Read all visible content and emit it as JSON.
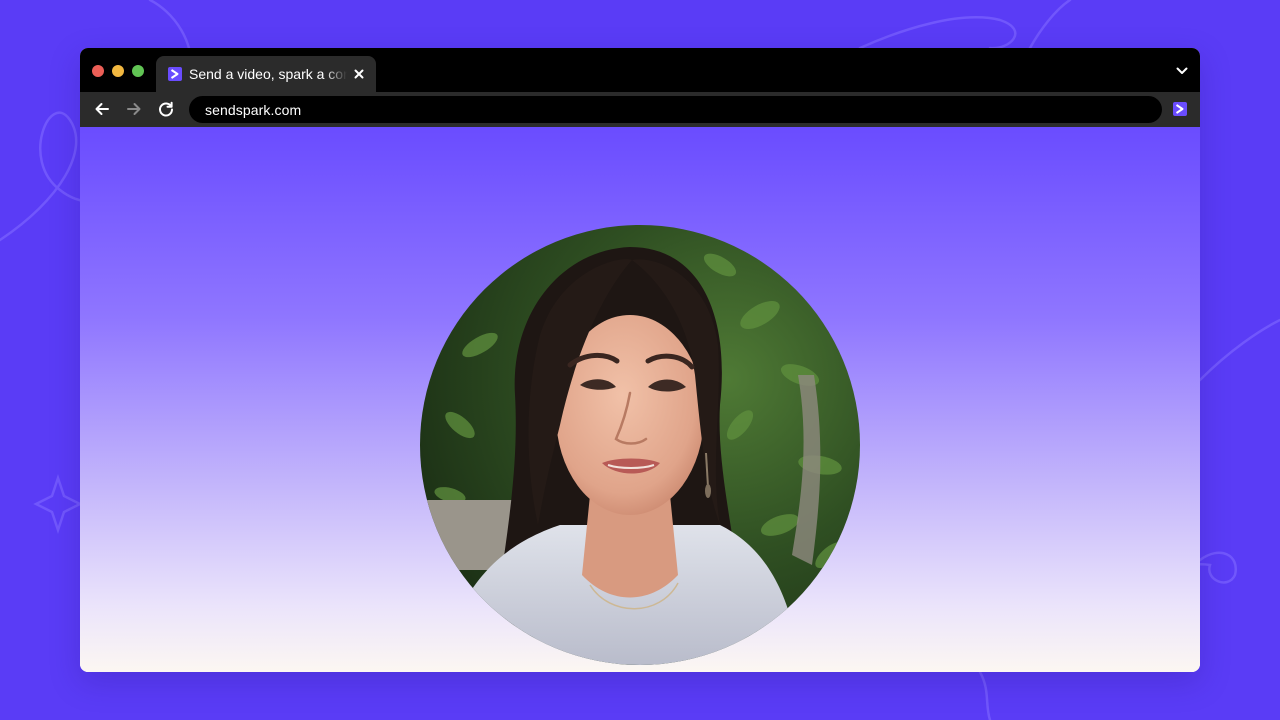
{
  "window": {
    "controls": [
      "close",
      "minimize",
      "maximize"
    ]
  },
  "tab": {
    "title": "Send a video, spark a conversation",
    "favicon": "sendspark-logo-icon",
    "close_icon": "close-icon"
  },
  "toolbar": {
    "back_icon": "arrow-left-icon",
    "forward_icon": "arrow-right-icon",
    "reload_icon": "reload-icon",
    "url": "sendspark.com",
    "extension_icon": "sendspark-extension-icon",
    "tab_list_icon": "chevron-down-icon"
  },
  "page": {
    "video_bubble": "circular-video-bubble"
  },
  "colors": {
    "background": "#5a3cf6",
    "accent": "#6a4cff",
    "chrome_dark": "#000000",
    "chrome_mid": "#2b2b2b"
  }
}
